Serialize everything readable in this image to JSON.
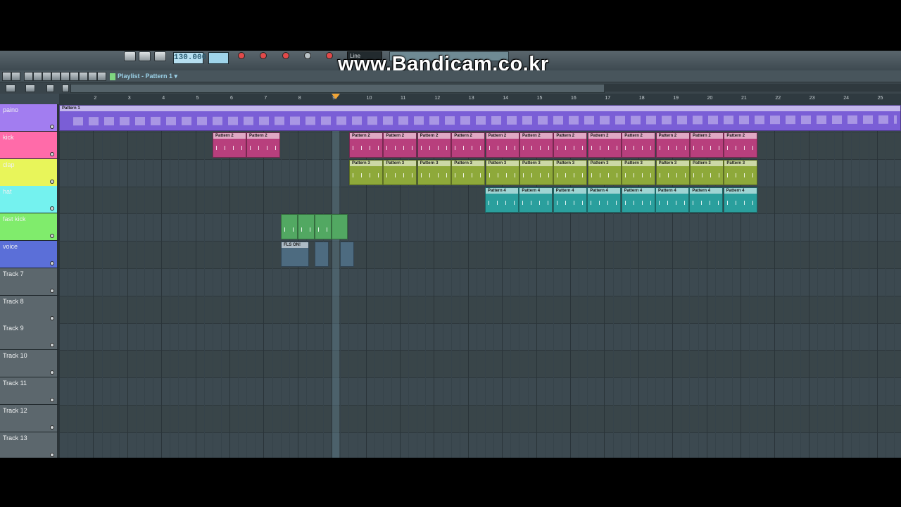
{
  "watermark": "www.Bandicam.co.kr",
  "toolbar": {
    "tempo": "130.000",
    "snap": "Line"
  },
  "playlist": {
    "title": "Playlist - Pattern 1 ▾"
  },
  "ruler": {
    "bars": [
      "2",
      "3",
      "4",
      "5",
      "6",
      "7",
      "8",
      "9",
      "10",
      "11",
      "12",
      "13",
      "14",
      "15",
      "16",
      "17",
      "18",
      "19",
      "20",
      "21",
      "22",
      "23",
      "24",
      "25"
    ]
  },
  "tracks": [
    {
      "name": "paino",
      "color": "#a27df0"
    },
    {
      "name": "kick",
      "color": "#ff6ba9"
    },
    {
      "name": "clap",
      "color": "#e8f55a"
    },
    {
      "name": "hat",
      "color": "#74f2ef"
    },
    {
      "name": "fast kick",
      "color": "#80ec6c"
    },
    {
      "name": "voice",
      "color": "#5b6fd8"
    },
    {
      "name": "Track 7",
      "color": "#5c676d"
    },
    {
      "name": "Track 8",
      "color": "#5c676d"
    },
    {
      "name": "Track 9",
      "color": "#5c676d"
    },
    {
      "name": "Track 10",
      "color": "#5c676d"
    },
    {
      "name": "Track 11",
      "color": "#5c676d"
    },
    {
      "name": "Track 12",
      "color": "#5c676d"
    },
    {
      "name": "Track 13",
      "color": "#5c676d"
    }
  ],
  "clips": {
    "pattern1": "Pattern 1",
    "pattern2": "Pattern 2",
    "pattern3": "Pattern 3",
    "pattern4": "Pattern 4",
    "voice": "FLS ON!",
    "colors": {
      "pattern1": "#7a5ed6",
      "pattern2": "#b83f7d",
      "pattern3": "#8ea93a",
      "pattern4": "#2a9f9d",
      "fastkick": "#52a862",
      "voice": "#4d6b80"
    }
  }
}
